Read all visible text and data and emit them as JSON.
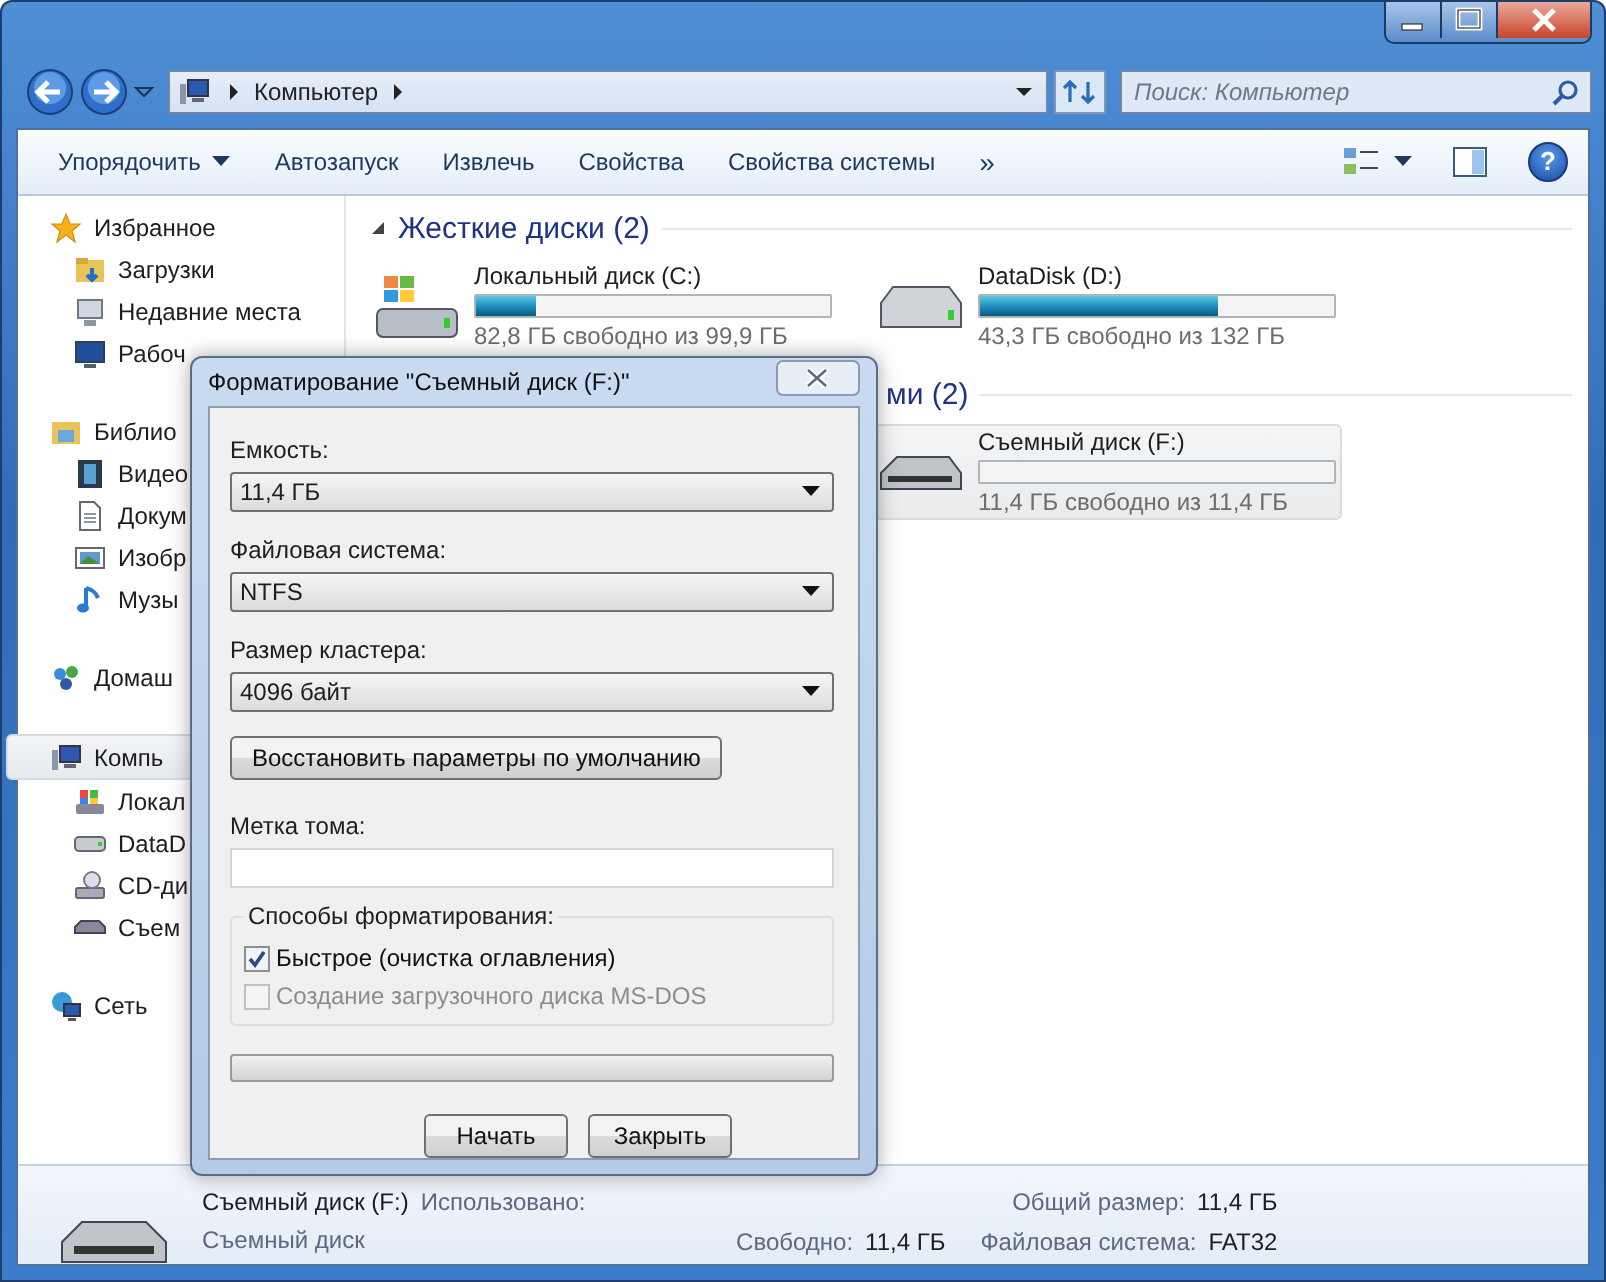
{
  "address_bar": {
    "crumbs": [
      "Компьютер"
    ]
  },
  "search": {
    "placeholder": "Поиск: Компьютер"
  },
  "toolbar": {
    "items": [
      {
        "label": "Упорядочить",
        "kind": "menu"
      },
      {
        "label": "Автозапуск",
        "kind": "button"
      },
      {
        "label": "Извлечь",
        "kind": "button"
      },
      {
        "label": "Свойства",
        "kind": "button"
      },
      {
        "label": "Свойства системы",
        "kind": "button"
      },
      {
        "label": "»",
        "kind": "more"
      }
    ],
    "help": "?"
  },
  "sidebar": {
    "groups": [
      {
        "label": "Избранное",
        "selected": false,
        "children": [
          {
            "label": "Загрузки",
            "selected": false
          },
          {
            "label": "Недавние места",
            "selected": false
          },
          {
            "label": "Рабоч",
            "selected": false
          }
        ]
      },
      {
        "label": "Библио",
        "selected": false,
        "children": [
          {
            "label": "Видео",
            "selected": false
          },
          {
            "label": "Докум",
            "selected": false
          },
          {
            "label": "Изобр",
            "selected": false
          },
          {
            "label": "Музы",
            "selected": false
          }
        ]
      },
      {
        "label": "Домаш",
        "selected": false
      },
      {
        "label": "Компь",
        "selected": true,
        "children": [
          {
            "label": "Локал",
            "selected": false
          },
          {
            "label": "DataD",
            "selected": false
          },
          {
            "label": "CD-ди",
            "selected": false
          },
          {
            "label": "Съем",
            "selected": false
          }
        ]
      },
      {
        "label": "Сеть",
        "selected": false
      }
    ]
  },
  "sections": [
    {
      "title": "Жесткие диски (2)",
      "drives": [
        {
          "name": "Локальный диск (C:)",
          "kind": "system",
          "level": 0.17,
          "free": "82,8 ГБ свободно из 99,9 ГБ",
          "selected": false
        },
        {
          "name": "DataDisk (D:)",
          "kind": "disk",
          "level": 0.67,
          "free": "43,3 ГБ свободно из 132 ГБ",
          "selected": false
        }
      ]
    },
    {
      "title": "ми (2)",
      "drives": [
        {
          "name": "Съемный диск (F:)",
          "kind": "removable",
          "level": 0,
          "free": "11,4 ГБ свободно из 11,4 ГБ",
          "selected": true
        }
      ]
    }
  ],
  "details": {
    "name": "Съемный диск (F:)",
    "used_label": "Использовано:",
    "type": "Съемный диск",
    "fields": [
      {
        "label": "Свободно:",
        "value": "11,4 ГБ"
      },
      {
        "label": "Общий размер:",
        "value": "11,4 ГБ"
      },
      {
        "label": "Файловая система:",
        "value": "FAT32"
      }
    ]
  },
  "dialog": {
    "title": "Форматирование \"Съемный диск (F:)\"",
    "selects": [
      {
        "label": "Емкость:",
        "value": "11,4 ГБ"
      },
      {
        "label": "Файловая система:",
        "value": "NTFS"
      },
      {
        "label": "Размер кластера:",
        "value": "4096 байт"
      }
    ],
    "restore_button": "Восстановить параметры по умолчанию",
    "volume_label": {
      "label": "Метка тома:"
    },
    "options_group": {
      "title": "Способы форматирования:",
      "options": [
        {
          "label": "Быстрое (очистка оглавления)",
          "checked": true,
          "disabled": false
        },
        {
          "label": "Создание загрузочного диска MS-DOS",
          "checked": false,
          "disabled": true
        }
      ]
    },
    "progress": {
      "level": 0
    },
    "buttons": [
      "Начать",
      "Закрыть"
    ]
  }
}
